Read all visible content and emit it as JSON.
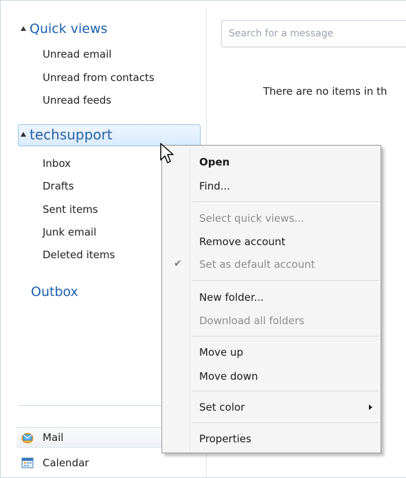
{
  "quick_views": {
    "title": "Quick views",
    "items": [
      "Unread email",
      "Unread from contacts",
      "Unread feeds"
    ]
  },
  "account": {
    "name": "techsupport",
    "folders": [
      "Inbox",
      "Drafts",
      "Sent items",
      "Junk email",
      "Deleted items"
    ]
  },
  "outbox": "Outbox",
  "nav": {
    "mail": {
      "label": "Mail",
      "icon": "mail-icon"
    },
    "calendar": {
      "label": "Calendar",
      "icon": "calendar-icon"
    }
  },
  "search": {
    "placeholder": "Search for a message"
  },
  "message_list": {
    "empty_text": "There are no items in th"
  },
  "context_menu": {
    "open": "Open",
    "find": "Find...",
    "select_quick_views": "Select quick views...",
    "remove_account": "Remove account",
    "set_default": "Set as default account",
    "new_folder": "New folder...",
    "download_all": "Download all folders",
    "move_up": "Move up",
    "move_down": "Move down",
    "set_color": "Set color",
    "properties": "Properties"
  },
  "colors": {
    "accent": "#1b5fae",
    "selection": "#d9ebfd",
    "disabled": "#8c8c8c"
  }
}
